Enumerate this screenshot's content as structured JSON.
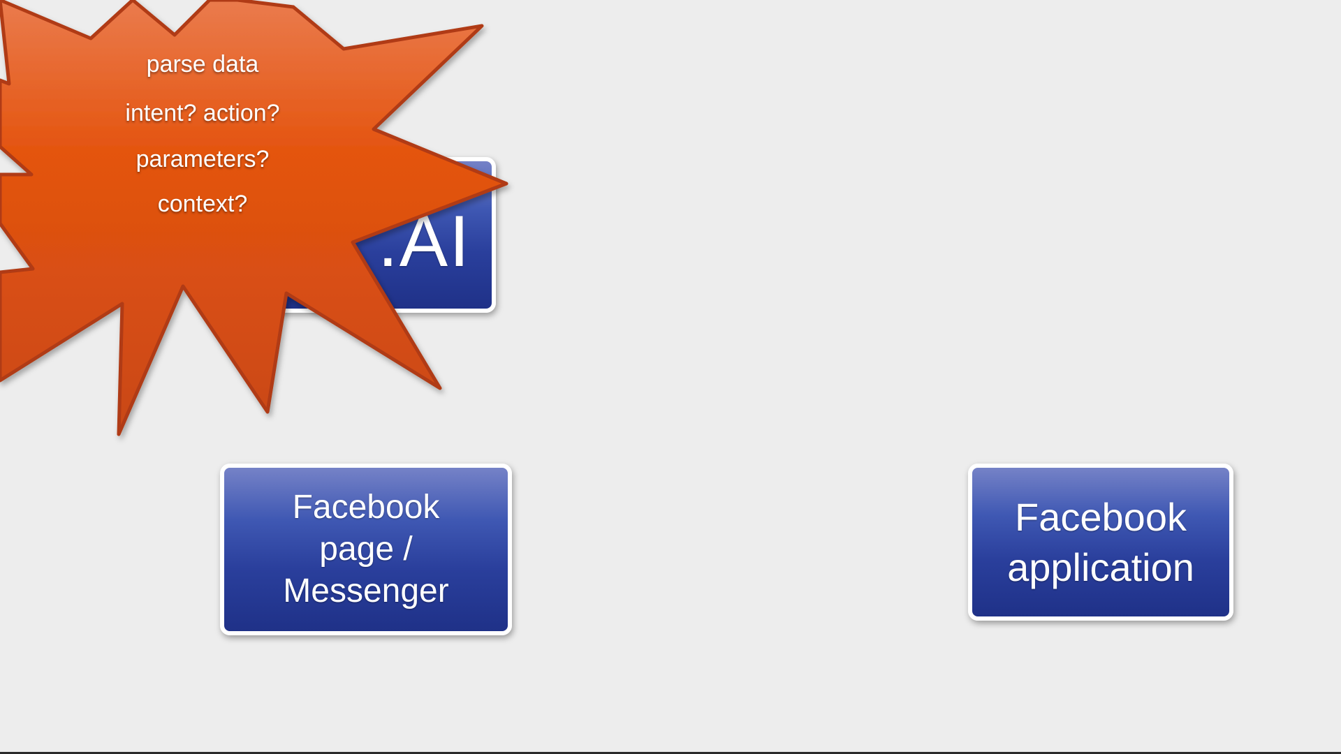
{
  "diagram": {
    "nodes": {
      "api_ai": {
        "label": ".AI"
      },
      "facebook_page": {
        "label": "Facebook\npage /\nMessenger"
      },
      "facebook_app": {
        "label": "Facebook\napplication"
      }
    },
    "burst": {
      "lines": [
        "parse data",
        "intent? action?",
        "parameters?",
        "context?"
      ]
    }
  },
  "colors": {
    "background": "#ededed",
    "box_top": "#7582c7",
    "box_bottom": "#1f3188",
    "burst_fill": "#e4540f",
    "burst_outline": "#b03a12"
  }
}
